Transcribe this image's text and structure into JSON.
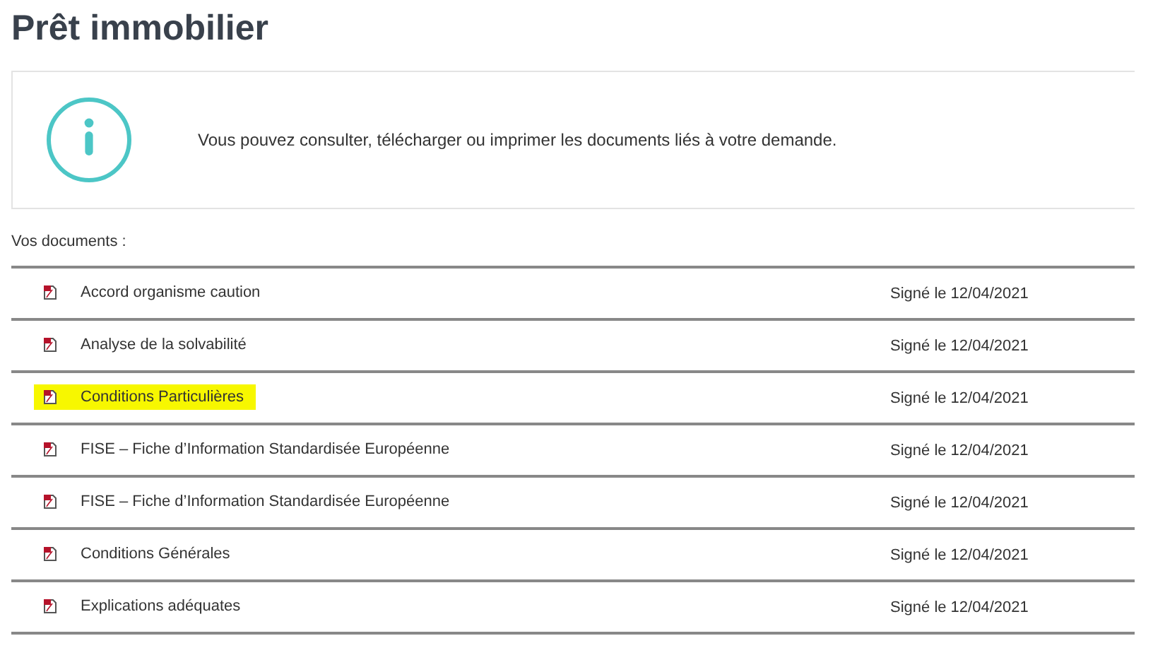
{
  "title": "Prêt immobilier",
  "info": {
    "message": "Vous pouvez consulter, télécharger ou imprimer les documents liés à votre demande."
  },
  "documents": {
    "label": "Vos documents :",
    "rows": [
      {
        "name": "Accord organisme caution",
        "status": "Signé le 12/04/2021",
        "highlighted": false
      },
      {
        "name": "Analyse de la solvabilité",
        "status": "Signé le 12/04/2021",
        "highlighted": false
      },
      {
        "name": "Conditions Particulières",
        "status": "Signé le 12/04/2021",
        "highlighted": true
      },
      {
        "name": "FISE – Fiche d’Information Standardisée Européenne",
        "status": "Signé le 12/04/2021",
        "highlighted": false
      },
      {
        "name": "FISE – Fiche d’Information Standardisée Européenne",
        "status": "Signé le 12/04/2021",
        "highlighted": false
      },
      {
        "name": "Conditions Générales",
        "status": "Signé le 12/04/2021",
        "highlighted": false
      },
      {
        "name": "Explications adéquates",
        "status": "Signé le 12/04/2021",
        "highlighted": false
      }
    ]
  }
}
